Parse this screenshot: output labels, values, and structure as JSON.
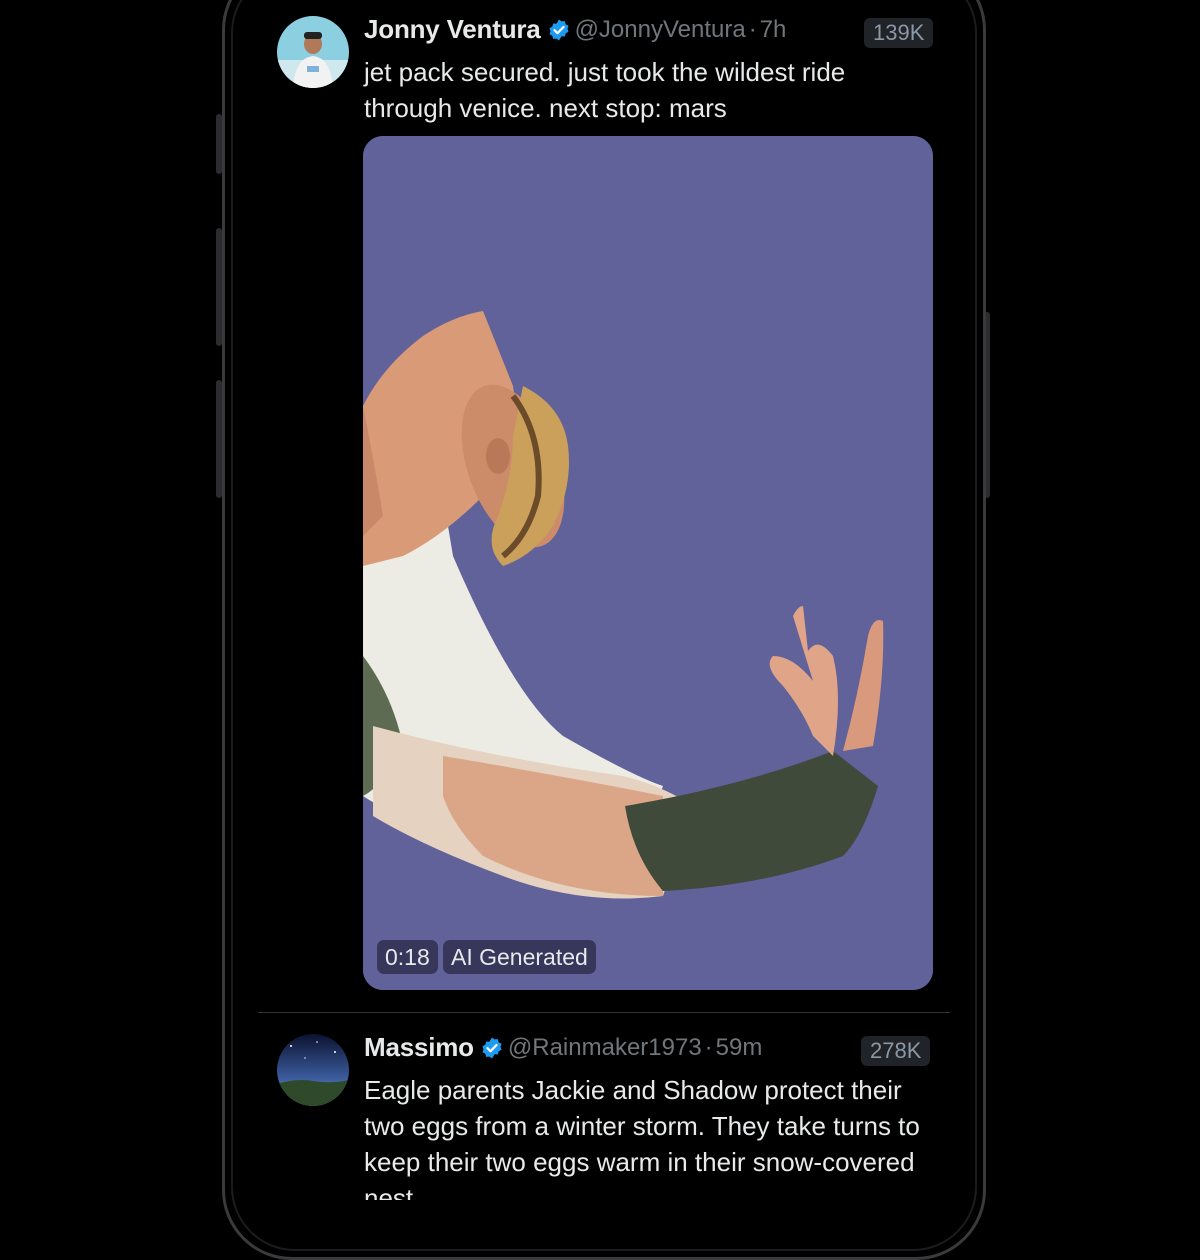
{
  "feed": {
    "posts": [
      {
        "name": "Jonny Ventura",
        "verified": true,
        "handle": "@JonnyVentura",
        "separator": "·",
        "time": "7h",
        "views": "139K",
        "text": "jet pack secured. just took the wildest ride through venice. next stop: mars",
        "media": {
          "type": "video",
          "duration": "0:18",
          "label": "AI Generated",
          "background_color": "#62629a"
        }
      },
      {
        "name": "Massimo",
        "verified": true,
        "handle": "@Rainmaker1973",
        "separator": "·",
        "time": "59m",
        "views": "278K",
        "text": "Eagle parents Jackie and Shadow protect their two eggs from a winter storm. They take turns to keep their two eggs warm in their snow-covered nest"
      }
    ]
  },
  "colors": {
    "background": "#000000",
    "text_primary": "#e7e9ea",
    "text_secondary": "#71767b",
    "verified_blue": "#1d9bf0"
  },
  "icons": [
    "verified-badge-icon"
  ]
}
